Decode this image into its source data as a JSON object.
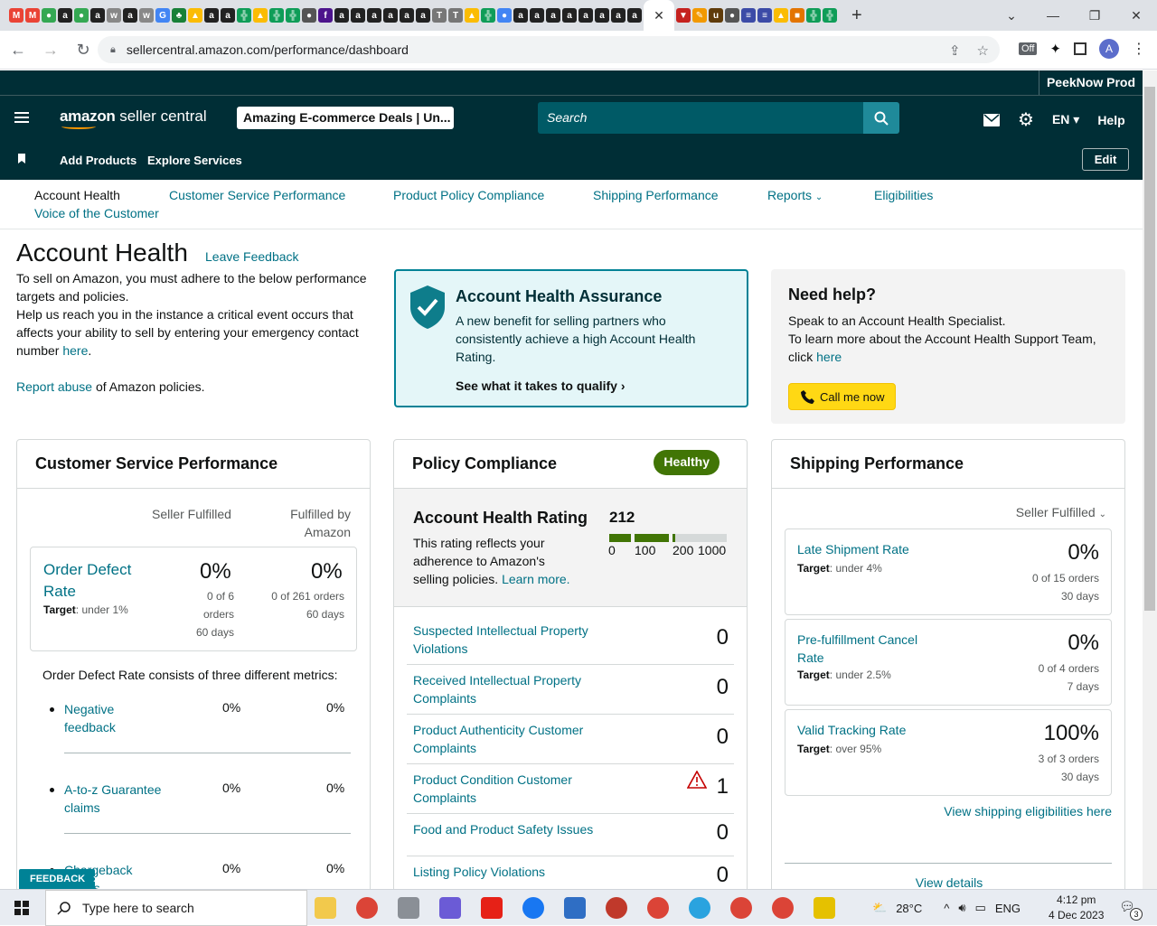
{
  "browser": {
    "url": "sellercentral.amazon.com/performance/dashboard",
    "close_tab": "✕",
    "new_tab": "+",
    "profile_initial": "A"
  },
  "header": {
    "account_name": "PeekNow Prod",
    "logo_text_bold": "amazon",
    "logo_text_rest": " seller central",
    "store_selector": "Amazing E-commerce Deals | Un...",
    "search_placeholder": "Search",
    "language": "EN",
    "help": "Help"
  },
  "quicknav": {
    "add_products": "Add Products",
    "explore_services": "Explore Services",
    "edit": "Edit"
  },
  "subnav": {
    "account_health": "Account Health",
    "customer_service": "Customer Service Performance",
    "policy_compliance": "Product Policy Compliance",
    "shipping": "Shipping Performance",
    "reports": "Reports",
    "eligibilities": "Eligibilities",
    "voice": "Voice of the Customer"
  },
  "page": {
    "title": "Account Health",
    "leave_feedback": "Leave Feedback",
    "intro1": "To sell on Amazon, you must adhere to the below performance targets and policies.",
    "intro2a": "Help us reach you in the instance a critical event occurs that affects your ability to sell by entering your emergency contact number ",
    "intro2_link": "here",
    "intro2b": ".",
    "report_link": "Report abuse",
    "report_rest": " of Amazon policies."
  },
  "aha": {
    "title": "Account Health Assurance",
    "body": "A new benefit for selling partners who consistently achieve a high Account Health Rating.",
    "qualify": "See what it takes to qualify"
  },
  "help": {
    "title": "Need help?",
    "line1": "Speak to an Account Health Specialist.",
    "line2": "To learn more about the Account Health Support Team, click ",
    "link": "here",
    "call": "Call me now"
  },
  "csp": {
    "title": "Customer Service Performance",
    "col_seller": "Seller Fulfilled",
    "col_fba1": "Fulfilled by",
    "col_fba2": "Amazon",
    "odr_label": "Order Defect Rate",
    "odr_target_label": "Target",
    "odr_target": ": under 1%",
    "seller_pct": "0%",
    "seller_l1": "0 of 6",
    "seller_l2": "orders",
    "seller_l3": "60 days",
    "fba_pct": "0%",
    "fba_l1": "0 of 261 orders",
    "fba_l2": "60 days",
    "consists": "Order Defect Rate consists of three different metrics:",
    "metrics": [
      {
        "label": "Negative feedback",
        "seller": "0%",
        "fba": "0%"
      },
      {
        "label": "A-to-z Guarantee claims",
        "seller": "0%",
        "fba": "0%"
      },
      {
        "label": "Chargeback claims",
        "seller": "0%",
        "fba": "0%"
      }
    ]
  },
  "policy": {
    "title": "Policy Compliance",
    "status": "Healthy",
    "ahr_title": "Account Health Rating",
    "ahr_text": "This rating reflects your adherence to Amazon's selling policies. ",
    "learn_more": "Learn more.",
    "rating": "212",
    "rating_value": 212,
    "rating_max": 1000,
    "ticks": [
      "0",
      "100",
      "200",
      "1000"
    ],
    "rows": [
      {
        "label": "Suspected Intellectual Property Violations",
        "value": "0"
      },
      {
        "label": "Received Intellectual Property Complaints",
        "value": "0"
      },
      {
        "label": "Product Authenticity Customer Complaints",
        "value": "0"
      },
      {
        "label": "Product Condition Customer Complaints",
        "value": "1"
      },
      {
        "label": "Food and Product Safety Issues",
        "value": "0"
      },
      {
        "label": "Listing Policy Violations",
        "value": "0"
      }
    ]
  },
  "shipping": {
    "title": "Shipping Performance",
    "selector": "Seller Fulfilled",
    "metrics": [
      {
        "label": "Late Shipment Rate",
        "target_label": "Target",
        "target": ": under 4%",
        "pct": "0%",
        "orders": "0 of 15 orders",
        "days": "30 days"
      },
      {
        "label": "Pre-fulfillment Cancel Rate",
        "target_label": "Target",
        "target": ": under 2.5%",
        "pct": "0%",
        "orders": "0 of 4 orders",
        "days": "7 days"
      },
      {
        "label": "Valid Tracking Rate",
        "target_label": "Target",
        "target": ": over 95%",
        "pct": "100%",
        "orders": "3 of 3 orders",
        "days": "30 days"
      }
    ],
    "view_elig": "View shipping eligibilities here",
    "view_details": "View details"
  },
  "feedback": "FEEDBACK",
  "taskbar": {
    "search": "Type here to search",
    "temp": "28°C",
    "lang": "ENG",
    "time": "4:12 pm",
    "date": "4 Dec 2023",
    "notif": "3"
  },
  "colors": {
    "header": "#002e36",
    "link": "#007185",
    "healthy": "#417505",
    "call_button": "#ffd814"
  }
}
